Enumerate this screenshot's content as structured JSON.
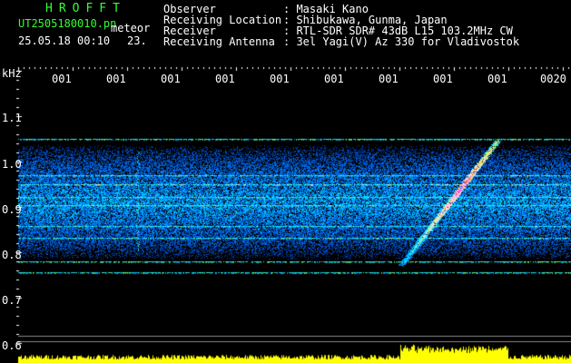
{
  "header": {
    "brand": "HROFFT",
    "filename": "UT2505180010.pn",
    "meteor_tag": "meteor",
    "datetime": "25.05.18 00:10",
    "count": "23.",
    "fields": [
      {
        "label": "Observer",
        "value": ": Masaki Kano"
      },
      {
        "label": "Receiving Location",
        "value": ": Shibukawa, Gunma, Japan"
      },
      {
        "label": "Receiver",
        "value": ": RTL-SDR SDR# 43dB L15 103.2MHz CW"
      },
      {
        "label": "Receiving Antenna",
        "value": ": 3el Yagi(V) Az 330 for Vladivostok"
      }
    ]
  },
  "axis": {
    "unit": "kHz",
    "y_ticks": [
      "1.1",
      "1.0",
      "0.9",
      "0.8",
      "0.7",
      "0.6"
    ],
    "x_ticks": [
      "001",
      "001",
      "001",
      "001",
      "001",
      "001",
      "001",
      "001",
      "001",
      "0020"
    ]
  },
  "colors": {
    "background": "#000000",
    "text": "#ffffff",
    "accent": "#33ff33",
    "noise": "#0a2aa8",
    "echo": "#ff3b1f",
    "bottom_bar": "#ffff00"
  }
}
